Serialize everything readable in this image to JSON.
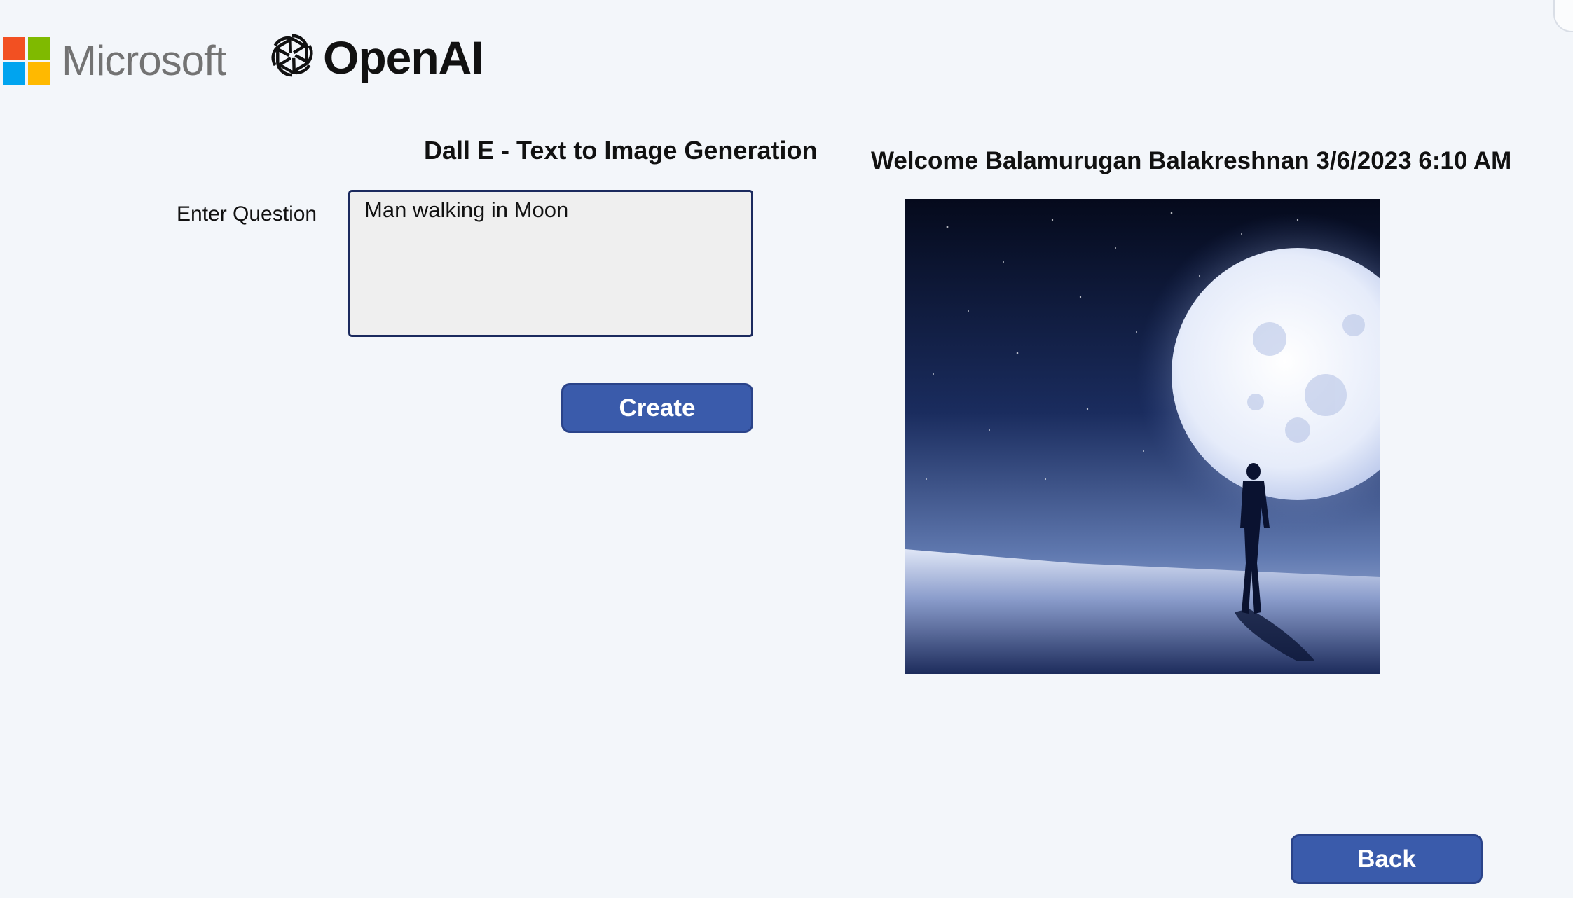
{
  "header": {
    "microsoft_brand": "Microsoft",
    "openai_brand": "OpenAI"
  },
  "left": {
    "title": "Dall E - Text to Image Generation",
    "question_label": "Enter Question",
    "question_value": "Man walking in Moon",
    "create_label": "Create"
  },
  "right": {
    "welcome": "Welcome Balamurugan Balakreshnan 3/6/2023 6:10 AM"
  },
  "footer": {
    "back_label": "Back"
  },
  "colors": {
    "background": "#f3f6fa",
    "button": "#3a5bab",
    "input_border": "#1b2a5e",
    "input_fill": "#efefef"
  },
  "icons": [
    "microsoft-logo-icon",
    "openai-logo-icon"
  ]
}
